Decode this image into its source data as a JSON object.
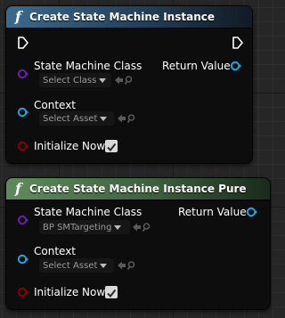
{
  "nodes": [
    {
      "title": "Create State Machine Instance",
      "pins": {
        "state_machine_class": {
          "label": "State Machine Class",
          "value": "Select Class"
        },
        "return_value": {
          "label": "Return Value"
        },
        "context": {
          "label": "Context",
          "value": "Select Asset"
        },
        "initialize_now": {
          "label": "Initialize Now",
          "checked": true
        }
      }
    },
    {
      "title": "Create State Machine Instance Pure",
      "pins": {
        "state_machine_class": {
          "label": "State Machine Class",
          "value": "BP SMTargeting"
        },
        "return_value": {
          "label": "Return Value"
        },
        "context": {
          "label": "Context",
          "value": "Select Asset"
        },
        "initialize_now": {
          "label": "Initialize Now",
          "checked": true
        }
      }
    }
  ],
  "icons": {
    "function": "function-icon",
    "exec": "exec-pin-icon",
    "class_pin": "purple-class-pin-icon",
    "object_pin": "blue-object-pin-icon",
    "bool_pin": "red-bool-pin-icon",
    "use_selected": "use-selected-arrow-icon",
    "browse": "browse-magnifier-icon",
    "checkmark": "checkmark-icon"
  },
  "colors": {
    "header_impure": "#3b6a8d",
    "header_pure": "#5f8c5c",
    "class_pin": "#6b1fa8",
    "object_pin": "#1aa6e0",
    "bool_pin": "#8c0000",
    "node_body": "#0d0d0d"
  }
}
